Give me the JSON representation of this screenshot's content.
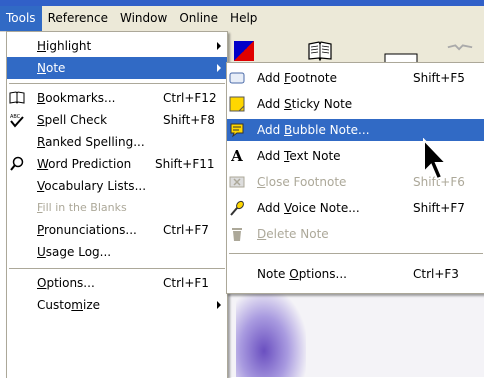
{
  "menubar": {
    "items": [
      {
        "label": "Tools",
        "active": true
      },
      {
        "label": "Reference"
      },
      {
        "label": "Window"
      },
      {
        "label": "Online"
      },
      {
        "label": "Help"
      }
    ]
  },
  "tools_menu": {
    "items": [
      {
        "pre": "",
        "u": "H",
        "post": "ighlight",
        "shortcut": "",
        "submenu": true
      },
      {
        "pre": "",
        "u": "N",
        "post": "ote",
        "shortcut": "",
        "submenu": true,
        "highlighted": true
      },
      {
        "pre": "",
        "u": "B",
        "post": "ookmarks...",
        "shortcut": "Ctrl+F12",
        "icon": "bookmarks-icon"
      },
      {
        "pre": "",
        "u": "S",
        "post": "pell Check",
        "shortcut": "Shift+F8",
        "icon": "spell-check-icon"
      },
      {
        "pre": "",
        "u": "R",
        "post": "anked Spelling...",
        "shortcut": ""
      },
      {
        "pre": "",
        "u": "W",
        "post": "ord Prediction",
        "shortcut": "Shift+F11",
        "icon": "word-prediction-icon"
      },
      {
        "pre": "",
        "u": "V",
        "post": "ocabulary Lists...",
        "shortcut": ""
      },
      {
        "pre": "",
        "u": "F",
        "post": "ill in the Blanks",
        "shortcut": "",
        "disabled": true
      },
      {
        "pre": "",
        "u": "P",
        "post": "ronunciations...",
        "shortcut": "Ctrl+F7"
      },
      {
        "pre": "",
        "u": "U",
        "post": "sage Log...",
        "shortcut": ""
      },
      {
        "pre": "",
        "u": "O",
        "post": "ptions...",
        "shortcut": "Ctrl+F1"
      },
      {
        "pre": "Custo",
        "u": "m",
        "post": "ize",
        "shortcut": "",
        "submenu": true
      }
    ]
  },
  "note_submenu": {
    "items": [
      {
        "pre": "Add ",
        "u": "F",
        "post": "ootnote",
        "shortcut": "Shift+F5",
        "icon": "footnote-icon"
      },
      {
        "pre": "Add ",
        "u": "S",
        "post": "ticky Note",
        "shortcut": "",
        "icon": "sticky-note-icon"
      },
      {
        "pre": "Add ",
        "u": "B",
        "post": "ubble Note...",
        "shortcut": "",
        "icon": "bubble-note-icon",
        "highlighted": true
      },
      {
        "pre": "Add ",
        "u": "T",
        "post": "ext Note",
        "shortcut": "",
        "icon": "text-note-icon"
      },
      {
        "pre": "",
        "u": "C",
        "post": "lose Footnote",
        "shortcut": "Shift+F6",
        "icon": "close-footnote-icon",
        "disabled": true
      },
      {
        "pre": "Add ",
        "u": "V",
        "post": "oice Note...",
        "shortcut": "Shift+F7",
        "icon": "voice-note-icon"
      },
      {
        "pre": "",
        "u": "D",
        "post": "elete Note",
        "shortcut": "",
        "icon": "delete-note-icon",
        "disabled": true
      },
      {
        "pre": "Note ",
        "u": "O",
        "post": "ptions...",
        "shortcut": "Ctrl+F3"
      }
    ]
  },
  "colors": {
    "highlight": "#316ac5",
    "menu_bg": "#ffffff",
    "disabled": "#aca899"
  }
}
